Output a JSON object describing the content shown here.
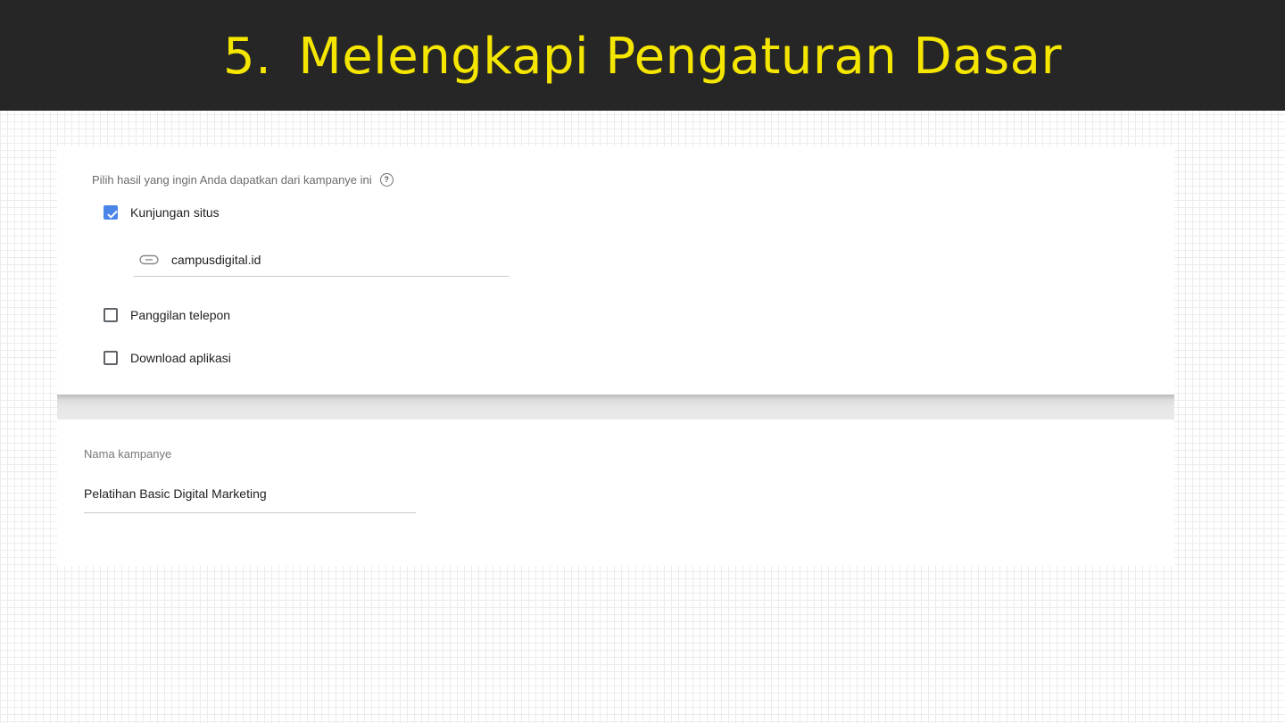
{
  "header": {
    "number": "5.",
    "title": "Melengkapi Pengaturan Dasar",
    "background": "#262626",
    "title_color": "#f5e600"
  },
  "goals": {
    "question": "Pilih hasil yang ingin Anda dapatkan dari kampanye ini",
    "help_icon": "help-circle-icon",
    "options": [
      {
        "label": "Kunjungan situs",
        "checked": true
      },
      {
        "label": "Panggilan telepon",
        "checked": false
      },
      {
        "label": "Download aplikasi",
        "checked": false
      }
    ],
    "website": {
      "icon": "link-icon",
      "value": "campusdigital.id"
    },
    "checkbox_color": "#4a86e8"
  },
  "campaign": {
    "label": "Nama kampanye",
    "value": "Pelatihan Basic Digital Marketing"
  }
}
